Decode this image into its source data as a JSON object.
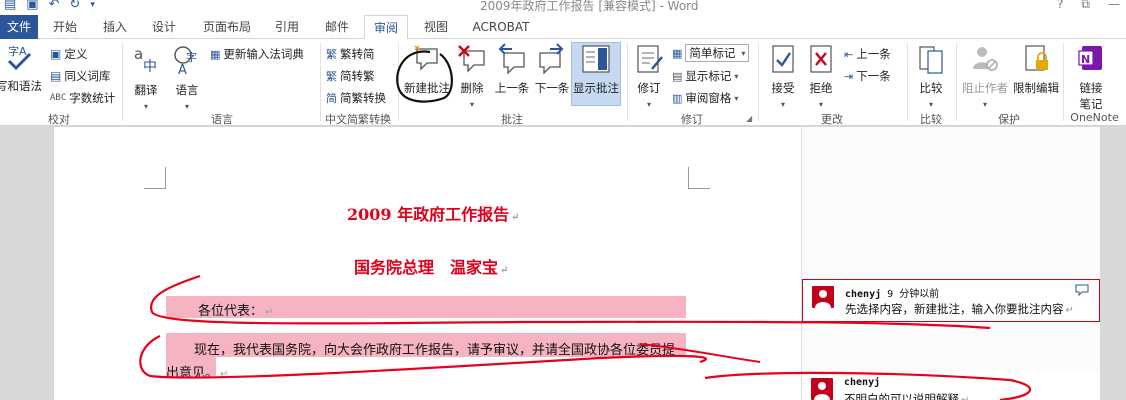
{
  "window": {
    "title": "2009年政府工作报告 [兼容模式] - Word",
    "help": "?",
    "restore": "⧉",
    "minimize": "—"
  },
  "tabs": [
    "文件",
    "开始",
    "插入",
    "设计",
    "页面布局",
    "引用",
    "邮件",
    "审阅",
    "视图",
    "ACROBAT"
  ],
  "active_tab": "审阅",
  "ribbon": {
    "proofing": {
      "label": "校对",
      "spelling": "写和语法",
      "define": "定义",
      "thesaurus": "同义词库",
      "word_count": "字数统计"
    },
    "language": {
      "label": "语言",
      "translate": "翻译",
      "language": "语言",
      "update_ime": "更新输入法词典"
    },
    "chinese_conversion": {
      "label": "中文简繁转换",
      "to_simplified": "繁转简",
      "to_traditional": "简转繁",
      "convert": "简繁转换"
    },
    "comments": {
      "label": "批注",
      "new": "新建批注",
      "delete": "删除",
      "previous": "上一条",
      "next": "下一条",
      "show": "显示批注"
    },
    "tracking": {
      "label": "修订",
      "track_changes": "修订",
      "markup_select": "简单标记",
      "show_markup": "显示标记",
      "reviewing_pane": "审阅窗格"
    },
    "changes": {
      "label": "更改",
      "accept": "接受",
      "reject": "拒绝",
      "previous": "上一条",
      "next": "下一条"
    },
    "compare": {
      "label": "比较",
      "compare": "比较"
    },
    "protect": {
      "label": "保护",
      "block_authors": "阻止作者",
      "restrict_editing": "限制编辑"
    },
    "onenote": {
      "label": "OneNote",
      "linked_notes_1": "链接",
      "linked_notes_2": "笔记"
    }
  },
  "document": {
    "title": "2009 年政府工作报告",
    "author_line": "国务院总理　温家宝",
    "para1": "各位代表：",
    "para2_line1": "现在，我代表国务院，向大会作政府工作报告，请予审议，并请全国政协各位委员提",
    "para2_line2": "出意见。",
    "paragraph_mark": "↵"
  },
  "comments": [
    {
      "author": "chenyj",
      "time": "9 分钟以前",
      "text": "先选择内容，新建批注，输入你要批注内容"
    },
    {
      "author": "chenyj",
      "time": "",
      "text": "不明白的可以说明解释"
    }
  ],
  "colors": {
    "word_blue": "#2b579a",
    "title_red": "#e0001b",
    "highlight_pink": "#f6b3c1",
    "ink_red": "#e8001c"
  }
}
